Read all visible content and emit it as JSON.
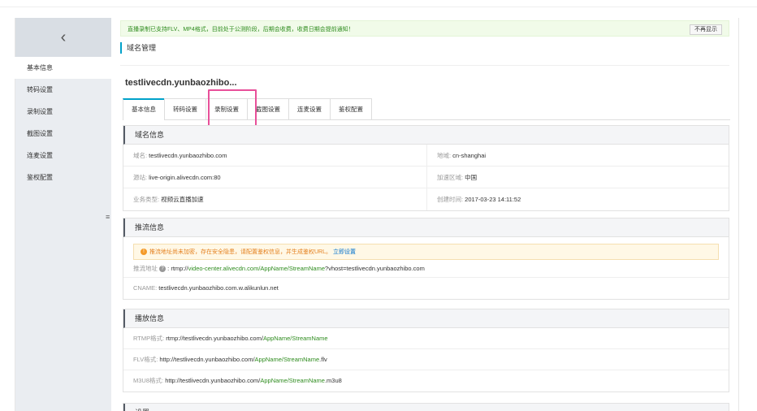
{
  "sidebar": {
    "back_icon": "chevron-left-icon",
    "items": [
      {
        "label": "基本信息",
        "active": true
      },
      {
        "label": "转码设置",
        "active": false
      },
      {
        "label": "录制设置",
        "active": false
      },
      {
        "label": "截图设置",
        "active": false
      },
      {
        "label": "连麦设置",
        "active": false
      },
      {
        "label": "鉴权配置",
        "active": false
      }
    ],
    "toggle_icon": "menu-toggle-icon"
  },
  "notice": {
    "text": "直播录制已支持FLV、MP4格式，目前处于公测阶段，后期会收费，收费日期会提前通知！",
    "dismiss_label": "不再显示"
  },
  "breadcrumb": "域名管理",
  "domain_title": "testlivecdn.yunbaozhibo...",
  "tabs": [
    {
      "label": "基本信息",
      "active": true
    },
    {
      "label": "转码设置",
      "active": false
    },
    {
      "label": "录制设置",
      "active": false
    },
    {
      "label": "截图设置",
      "active": false
    },
    {
      "label": "连麦设置",
      "active": false
    },
    {
      "label": "鉴权配置",
      "active": false
    }
  ],
  "domain_info": {
    "title": "域名信息",
    "rows": [
      {
        "lk": "域名: ",
        "lv": "testlivecdn.yunbaozhibo.com",
        "rk": "地域: ",
        "rv": "cn-shanghai"
      },
      {
        "lk": "源站: ",
        "lv": "live-origin.alivecdn.com:80",
        "rk": "加速区域: ",
        "rv": "中国"
      },
      {
        "lk": "业务类型: ",
        "lv": "视频云直播加速",
        "rk": "创建时间: ",
        "rv": "2017-03-23 14:11:52"
      }
    ]
  },
  "push_info": {
    "title": "推流信息",
    "warning_text": "推流地址尚未加密，存在安全隐患，请配置鉴权信息，并生成鉴权URL。",
    "warning_link": "立即设置",
    "push_label": "推流地址",
    "push_prefix": " : rtmp://",
    "push_host": "video-center.alivecdn.com/",
    "push_app": "AppName/StreamName",
    "push_query": "?vhost=testlivecdn.yunbaozhibo.com",
    "cname_label": "CNAME: ",
    "cname_value": "testlivecdn.yunbaozhibo.com.w.alikunlun.net"
  },
  "play_info": {
    "title": "播放信息",
    "rtmp_label": "RTMP格式: ",
    "rtmp_base": "rtmp://testlivecdn.yunbaozhibo.com/",
    "rtmp_path": "AppName/StreamName",
    "flv_label": "FLV格式: ",
    "flv_base": "http://testlivecdn.yunbaozhibo.com/",
    "flv_path": "AppName/StreamName",
    "flv_ext": ".flv",
    "m3u8_label": "M3U8格式: ",
    "m3u8_base": "http://testlivecdn.yunbaozhibo.com/",
    "m3u8_path": "AppName/StreamName",
    "m3u8_ext": ".m3u8"
  },
  "settings_partial": "设置"
}
